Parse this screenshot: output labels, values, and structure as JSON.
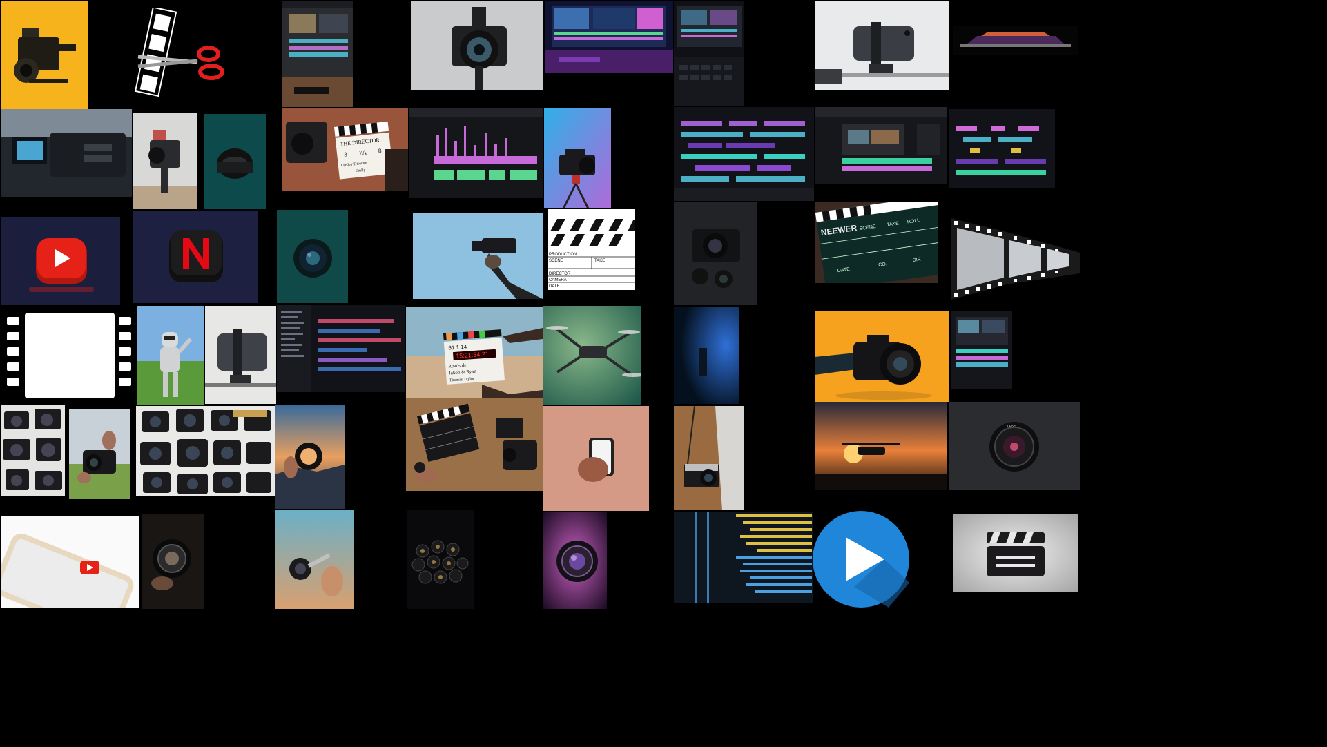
{
  "clapperboard_white": {
    "fields": [
      "PRODUCTION",
      "SCENE",
      "TAKE",
      "DIRECTOR",
      "CAMERA",
      "DATE"
    ]
  },
  "clapperboard_director": {
    "title": "THE DIRECTOR",
    "values": [
      "3",
      "7A",
      "8"
    ],
    "handwriting": "Upsley Director",
    "subline": "Emily"
  },
  "clapperboard_desert": {
    "numbers": "61   1   14",
    "timecode": "15:21:34:21",
    "lines": [
      "Roadside",
      "Jakob & Ryan",
      "Thomas Taylor"
    ]
  },
  "clapperboard_neewer": {
    "brand": "NEEWER",
    "fields": [
      "SCENE",
      "TAKE",
      "ROLL",
      "DATE",
      "CO.",
      "DIR"
    ]
  },
  "camera_lens_label": "LENS",
  "palette": {
    "background": "#000000",
    "youtube_red": "#e62117",
    "netflix_red": "#e50914",
    "play_blue": "#1f86d9",
    "camera_yellow": "#f7b31b",
    "camera_orange": "#f7a21f",
    "timeline_purple": "#c56ad8",
    "timeline_green": "#5ad68f"
  }
}
